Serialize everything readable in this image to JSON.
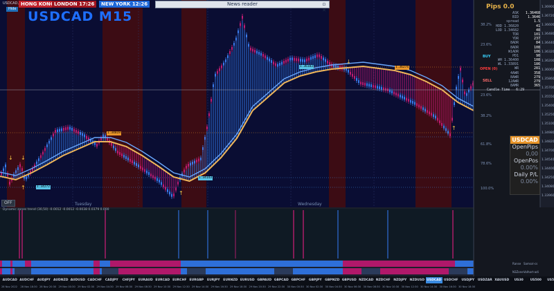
{
  "top_label": "USDCAD,M15",
  "hide_label": "Hide",
  "sessions": [
    {
      "city": "HONG KONG",
      "time": "01:26",
      "color": "#c0202a"
    },
    {
      "city": "LONDON",
      "time": "17:26",
      "color": "#a0141e"
    },
    {
      "city": "NEW YORK",
      "time": "12:26",
      "color": "#1c66d6"
    }
  ],
  "symbol_title": "USDCAD M15",
  "news_reader": "News reader",
  "pips_label": "Pips 0.0",
  "info_rows": [
    {
      "label": "ASK",
      "value": "1.36468"
    },
    {
      "label": "BID",
      "value": "1.3646"
    },
    {
      "label": "spread",
      "value": "1.5"
    },
    {
      "label": "HOD 1.36820",
      "value": "41"
    },
    {
      "label": "LOD 1.34682",
      "value": "48"
    },
    {
      "label": "TDR",
      "value": "101"
    },
    {
      "label": "YDR",
      "value": "237"
    },
    {
      "label": "8ADR",
      "value": "84"
    },
    {
      "label": "8ADR",
      "value": "108"
    },
    {
      "label": "W1ADR",
      "value": "106"
    },
    {
      "label": "PD1",
      "value": "90"
    }
  ],
  "buy_label": "BUY",
  "open_label": "OPEN (0)",
  "sell_label": "SELL",
  "info_rows2": [
    {
      "label": "WH 1.36400",
      "value": "108"
    },
    {
      "label": "WL 1.33891",
      "value": "186"
    },
    {
      "label": "WR",
      "value": "281"
    },
    {
      "label": "4AWR",
      "value": "358"
    },
    {
      "label": "8AWR",
      "value": "279"
    },
    {
      "label": "12AWR",
      "value": "279"
    },
    {
      "label": "8AMR",
      "value": "365"
    }
  ],
  "candle_time_label": "Candle Time",
  "candle_time": "6:29",
  "pct_levels": [
    "38.2%",
    "23.6%",
    "23.6%",
    "38.2%",
    "61.8%",
    "78.6%",
    "100.0%"
  ],
  "price_axis": [
    "1.36900",
    "1.36720",
    "1.36600",
    "1.36480",
    "1.36440",
    "1.36320",
    "1.36200",
    "1.36060",
    "1.35860",
    "1.35700",
    "1.35550",
    "1.35400",
    "1.35250",
    "1.35100",
    "1.34980",
    "1.34820",
    "1.34700",
    "1.34540",
    "1.34400",
    "1.34250",
    "1.34080",
    "1.33960"
  ],
  "stats_box": {
    "title": "USDCAD",
    "open_pips_label": "OpenPips",
    "open_pips": "0,00",
    "open_pos_label": "OpenPos",
    "open_pos": "0.00%",
    "daily_pl_label": "Daily P/L",
    "daily_pl": "0.00%"
  },
  "price_tags": [
    {
      "text": "1.34819",
      "color": "#e8952a"
    },
    {
      "text": "1.34272",
      "color": "#59c4e8"
    },
    {
      "text": "1.34143",
      "color": "#59c4e8"
    },
    {
      "text": "1.36183",
      "color": "#59c4e8"
    },
    {
      "text": "1.36274",
      "color": "#e8952a"
    }
  ],
  "day_labels": [
    "Tuesday",
    "Wednesday"
  ],
  "off_label": "OFF",
  "indicator_label": "Dynamic zones trend (30,50) -0.0012 -0.0012 -0.0038 0.0379 0.000",
  "row_labels": [
    "Ranse",
    "Samsxl-cs",
    "N3Zone",
    "Volhart-adi"
  ],
  "pairs": [
    "AUDCAD",
    "AUDCHF",
    "AUDJPY",
    "AUDNZD",
    "AUDUSD",
    "CADCHF",
    "CADJPY",
    "CHFJPY",
    "EURAUD",
    "EURCAD",
    "EURCHF",
    "EURGBP",
    "EURJPY",
    "EURNZD",
    "EURUSD",
    "GBPAUD",
    "GBPCAD",
    "GBPCHF",
    "GBPJPY",
    "GBPNZD",
    "GBPUSD",
    "NZDCAD",
    "NZDCHF",
    "NZDJPY",
    "NZDUSD",
    "USDCAD",
    "USDCHF",
    "USDJPY",
    "USDZAR",
    "XAUUSD",
    "US30",
    "US500",
    "US500"
  ],
  "active_pair": "USDCAD",
  "dates": [
    "28 Nov 2022",
    "28 Nov 18:30",
    "28 Nov 20:30",
    "29 Nov 00:30",
    "29 Nov 02:30",
    "29 Nov 04:30",
    "29 Nov 06:30",
    "29 Nov 08:30",
    "29 Nov 10:30",
    "29 Nov 12:30",
    "29 Nov 14:30",
    "29 Nov 16:30",
    "29 Nov 18:30",
    "29 Nov 20:30",
    "29 Nov 22:30",
    "30 Nov 00:30",
    "30 Nov 02:30",
    "30 Nov 04:30",
    "30 Nov 06:30",
    "30 Nov 08:30",
    "30 Nov 10:30",
    "30 Nov 12:30",
    "30 Nov 14:30",
    "30 Nov 16:30",
    "30 Nov 18:30"
  ],
  "colors": {
    "bg": "#0a0d33",
    "session": "#3c0c14",
    "bull": "#2e6fd8",
    "bear": "#b0186a",
    "ema": "#f0b65a",
    "ema2": "#6aa8ff"
  }
}
